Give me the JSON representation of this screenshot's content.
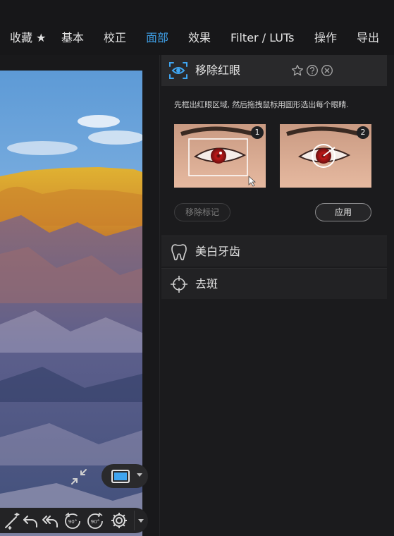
{
  "menu": {
    "tabs": [
      {
        "label": "收藏 ★"
      },
      {
        "label": "基本"
      },
      {
        "label": "校正"
      },
      {
        "label": "面部"
      },
      {
        "label": "效果"
      },
      {
        "label": "Filter / LUTs"
      },
      {
        "label": "操作"
      },
      {
        "label": "导出"
      }
    ],
    "active_color": "#3f9fe6"
  },
  "canvas": {
    "fit_icon": "shrink-arrows-icon",
    "view_mode_icon": "single-view-icon",
    "tools": [
      {
        "icon": "magic-wand-icon"
      },
      {
        "icon": "undo-icon"
      },
      {
        "icon": "undo-all-icon"
      },
      {
        "icon": "rotate-left-90-icon",
        "text": "90°"
      },
      {
        "icon": "rotate-right-90-icon",
        "text": "90°"
      },
      {
        "icon": "settings-gear-icon"
      }
    ]
  },
  "panel": {
    "red_eye": {
      "title": "移除红眼",
      "instruction": "先框出红眼区域, 然后拖拽鼠标用圆形选出每个眼睛.",
      "steps": [
        {
          "badge": "1"
        },
        {
          "badge": "2"
        }
      ],
      "remove_marks_label": "移除标记",
      "apply_label": "应用",
      "accent_color": "#3fa5f0"
    },
    "sections": [
      {
        "label": "美白牙齿",
        "icon": "tooth-icon"
      },
      {
        "label": "去斑",
        "icon": "crosshair-icon"
      }
    ]
  }
}
